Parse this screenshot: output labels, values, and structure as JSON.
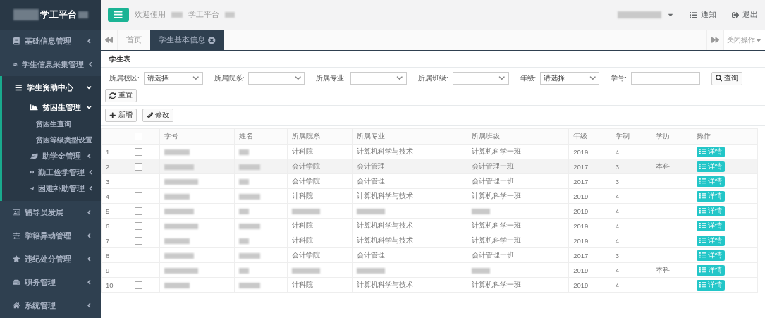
{
  "logo": {
    "text": "学工平台"
  },
  "sidebar": {
    "items": [
      {
        "label": "基础信息管理",
        "expanded": false
      },
      {
        "label": "学生信息采集管理",
        "expanded": false
      },
      {
        "label": "学生资助中心",
        "expanded": true,
        "children": [
          {
            "label": "贫困生管理",
            "expanded": true,
            "children": [
              {
                "label": "贫困生查询"
              },
              {
                "label": "贫困等级类型设置"
              }
            ]
          },
          {
            "label": "助学金管理",
            "expanded": false
          },
          {
            "label": "勤工俭学管理",
            "expanded": false
          },
          {
            "label": "困难补助管理",
            "expanded": false
          }
        ]
      },
      {
        "label": "辅导员发展",
        "expanded": false
      },
      {
        "label": "学籍异动管理",
        "expanded": false
      },
      {
        "label": "违纪处分管理",
        "expanded": false
      },
      {
        "label": "职务管理",
        "expanded": false
      },
      {
        "label": "系统管理",
        "expanded": false
      }
    ]
  },
  "header": {
    "welcome": [
      "欢迎使用",
      "学工平台"
    ],
    "actions": [
      {
        "label": "通知"
      },
      {
        "label": "退出"
      }
    ]
  },
  "tabs": [
    {
      "label": "首页",
      "selected": false
    },
    {
      "label": "学生基本信息",
      "selected": true
    }
  ],
  "close_menu": "关闭操作",
  "panel": {
    "title": "学生表",
    "filters": [
      {
        "label": "所属校区:",
        "kind": "select",
        "value": "请选择"
      },
      {
        "label": "所属院系:",
        "kind": "select"
      },
      {
        "label": "所属专业:",
        "kind": "select"
      },
      {
        "label": "所属班级:",
        "kind": "select"
      },
      {
        "label": "年级:",
        "kind": "select",
        "value": "请选择"
      },
      {
        "label": "学号:",
        "kind": "text"
      }
    ],
    "search_button": "查询",
    "reset_button": "重置",
    "toolbar": [
      "新增",
      "修改"
    ]
  },
  "table": {
    "select_all": {
      "checked": false
    },
    "columns": [
      "学号",
      "姓名",
      "所属院系",
      "所属专业",
      "所属班级",
      "年级",
      "学制",
      "学历",
      "操作"
    ],
    "rows": [
      {
        "index": "1",
        "checked": false,
        "highlighted": false,
        "dept": "计科院",
        "major": "计算机科学与技术",
        "class": "计算机科学一班",
        "grade": "2019",
        "years": "4",
        "action": "详情"
      },
      {
        "index": "2",
        "checked": false,
        "highlighted": true,
        "dept": "会计学院",
        "major": "会计管理",
        "class": "会计管理一班",
        "grade": "2017",
        "years": "3",
        "degree": "本科",
        "action": "详情"
      },
      {
        "index": "3",
        "checked": false,
        "highlighted": false,
        "dept": "会计学院",
        "major": "会计管理",
        "class": "会计管理一班",
        "grade": "2017",
        "years": "3",
        "action": "详情"
      },
      {
        "index": "4",
        "checked": false,
        "highlighted": false,
        "dept": "计科院",
        "major": "计算机科学与技术",
        "class": "计算机科学一班",
        "grade": "2019",
        "years": "4",
        "action": "详情"
      },
      {
        "index": "5",
        "checked": false,
        "highlighted": false,
        "grade": "2019",
        "years": "4",
        "action": "详情"
      },
      {
        "index": "6",
        "checked": false,
        "highlighted": false,
        "dept": "计科院",
        "major": "计算机科学与技术",
        "class": "计算机科学一班",
        "grade": "2019",
        "years": "4",
        "action": "详情"
      },
      {
        "index": "7",
        "checked": false,
        "highlighted": false,
        "dept": "计科院",
        "major": "计算机科学与技术",
        "class": "计算机科学一班",
        "grade": "2019",
        "years": "4",
        "action": "详情"
      },
      {
        "index": "8",
        "checked": false,
        "highlighted": false,
        "dept": "会计学院",
        "major": "会计管理",
        "class": "会计管理一班",
        "grade": "2017",
        "years": "3",
        "action": "详情"
      },
      {
        "index": "9",
        "checked": false,
        "highlighted": false,
        "grade": "2019",
        "years": "4",
        "degree": "本科",
        "action": "详情"
      },
      {
        "index": "10",
        "checked": false,
        "highlighted": false,
        "dept": "计科院",
        "major": "计算机科学与技术",
        "class": "计算机科学一班",
        "grade": "2019",
        "years": "4",
        "action": "详情"
      }
    ]
  }
}
